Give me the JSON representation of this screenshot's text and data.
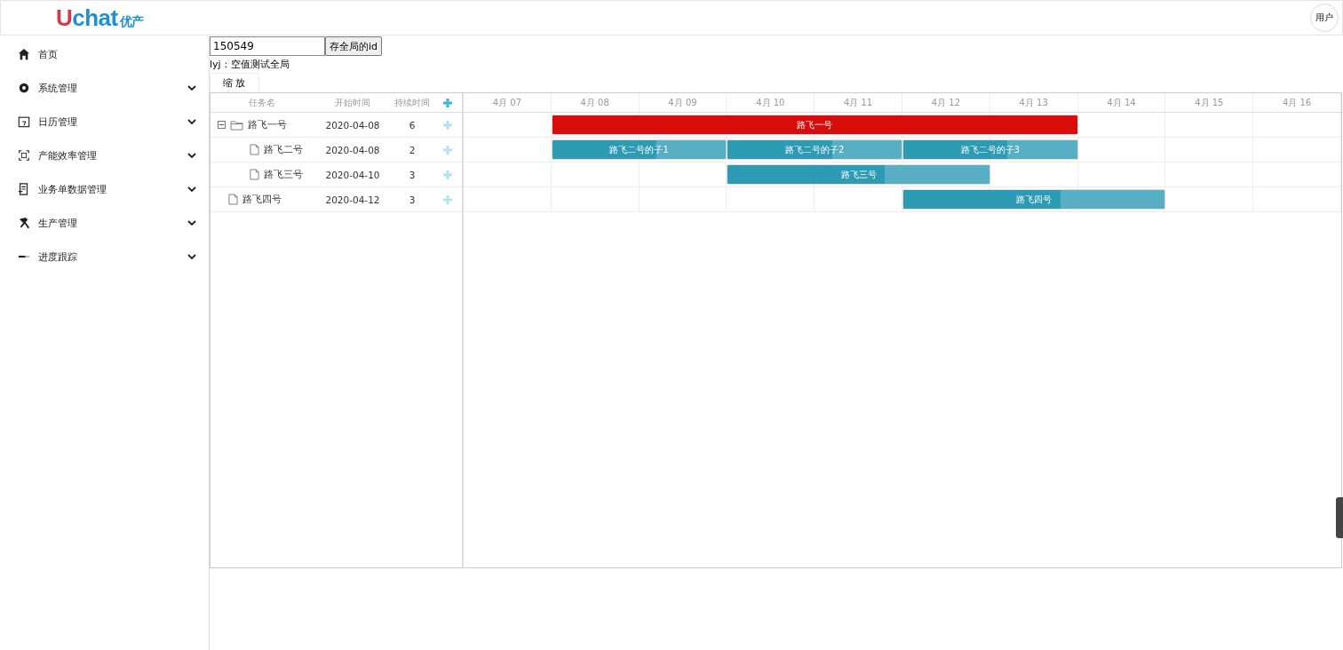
{
  "header": {
    "logo": {
      "text": "Uchat",
      "tag": "优产"
    },
    "user": "用户"
  },
  "sidebar": {
    "items": [
      {
        "label": "首页",
        "kind": "link"
      },
      {
        "label": "系统管理",
        "kind": "menu"
      },
      {
        "label": "日历管理",
        "kind": "menu"
      },
      {
        "label": "产能效率管理",
        "kind": "menu"
      },
      {
        "label": "业务单数据管理",
        "kind": "menu"
      },
      {
        "label": "生产管理",
        "kind": "menu"
      },
      {
        "label": "进度跟踪",
        "kind": "menu"
      }
    ]
  },
  "toolbar": {
    "id_value": "150549",
    "save_button": "存全局的id",
    "note": "lyj：空值测试全局",
    "zoom_button": "缩 放"
  },
  "gantt": {
    "columns": [
      "任务名",
      "开始时间",
      "持续时间"
    ],
    "days": [
      "4月 07",
      "4月 08",
      "4月 09",
      "4月 10",
      "4月 11",
      "4月 12",
      "4月 13",
      "4月 14",
      "4月 15",
      "4月 16"
    ],
    "tasks": [
      {
        "name": "路飞一号",
        "start": "2020-04-08",
        "duration": "6",
        "kind": "folder",
        "expanded": true,
        "bars": [
          {
            "label": "路飞一号",
            "level": 1,
            "color": "#d80c0c"
          }
        ],
        "children": [
          {
            "name": "路飞二号",
            "start": "2020-04-08",
            "duration": "2",
            "kind": "file",
            "bars": [
              {
                "label": "路飞二号的子1",
                "level": 0.6,
                "color": "#2e9bb5"
              },
              {
                "label": "路飞二号的子2",
                "level": 0.6,
                "color": "#2e9bb5"
              },
              {
                "label": "路飞二号的子3",
                "level": 0.6,
                "color": "#2e9bb5"
              }
            ]
          },
          {
            "name": "路飞三号",
            "start": "2020-04-10",
            "duration": "3",
            "kind": "file",
            "bars": [
              {
                "label": "路飞三号",
                "level": 0.6,
                "color": "#2e9bb5"
              }
            ]
          }
        ]
      },
      {
        "name": "路飞四号",
        "start": "2020-04-12",
        "duration": "3",
        "kind": "file",
        "bars": [
          {
            "label": "路飞四号",
            "level": 0.6,
            "color": "#2e9bb5"
          }
        ]
      }
    ]
  }
}
